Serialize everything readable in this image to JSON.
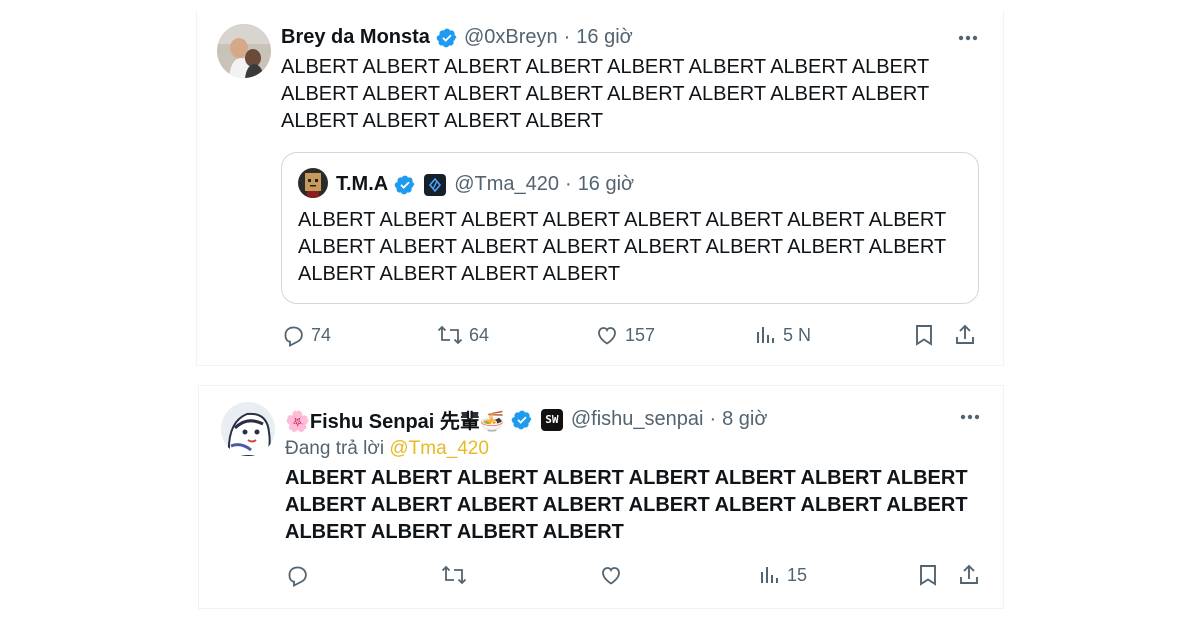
{
  "tweet1": {
    "name": "Brey da Monsta",
    "handle": "@0xBreyn",
    "separator": "·",
    "time": "16 giờ",
    "text": "ALBERT ALBERT ALBERT ALBERT ALBERT ALBERT ALBERT ALBERT\nALBERT ALBERT ALBERT ALBERT ALBERT ALBERT ALBERT ALBERT\nALBERT ALBERT ALBERT ALBERT",
    "quote": {
      "name": "T.M.A",
      "handle": "@Tma_420",
      "separator": "·",
      "time": "16 giờ",
      "text": "ALBERT ALBERT ALBERT ALBERT ALBERT ALBERT ALBERT ALBERT\nALBERT ALBERT ALBERT ALBERT ALBERT ALBERT ALBERT ALBERT\nALBERT ALBERT ALBERT ALBERT"
    },
    "stats": {
      "replies": "74",
      "reposts": "64",
      "likes": "157",
      "views": "5 N"
    }
  },
  "tweet2": {
    "name": "🌸Fishu Senpai 先輩🍜",
    "handle": "@fishu_senpai",
    "separator": "·",
    "time": "8 giờ",
    "replying_prefix": "Đang trả lời",
    "replying_to": "@Tma_420",
    "text": "ALBERT ALBERT ALBERT ALBERT ALBERT ALBERT ALBERT ALBERT\nALBERT ALBERT ALBERT ALBERT ALBERT ALBERT ALBERT ALBERT\nALBERT ALBERT ALBERT ALBERT",
    "affiliate_badge": "SW",
    "stats": {
      "views": "15"
    }
  },
  "colors": {
    "verified": "#1d9bf0",
    "muted": "#536471",
    "mention": "#e8b923",
    "border": "#cfd9de"
  }
}
